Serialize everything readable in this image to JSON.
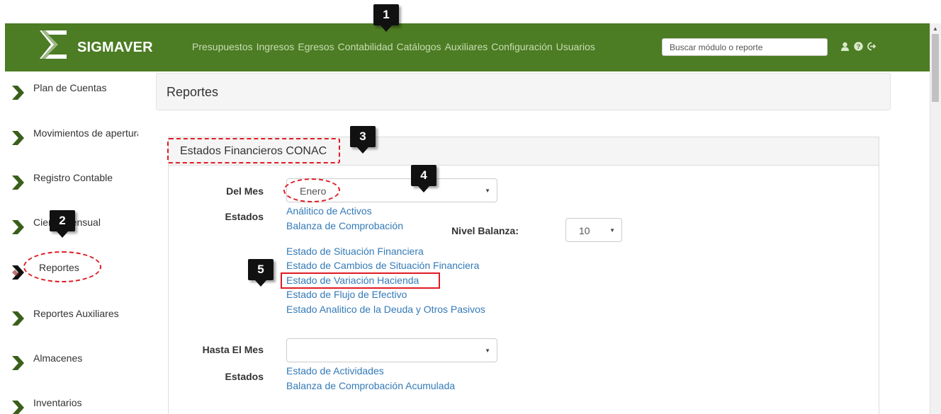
{
  "app": {
    "name": "SIGMAVER"
  },
  "nav": {
    "items": [
      "Presupuestos",
      "Ingresos",
      "Egresos",
      "Contabilidad",
      "Catálogos",
      "Auxiliares",
      "Configuración",
      "Usuarios"
    ],
    "search_placeholder": "Buscar módulo o reporte",
    "icons": [
      "user-icon",
      "question-circle-icon",
      "sign-out-icon"
    ]
  },
  "sidebar": {
    "items": [
      {
        "label": "Plan de Cuentas",
        "active": false
      },
      {
        "label": "Movimientos de apertura",
        "active": false
      },
      {
        "label": "Registro Contable",
        "active": false
      },
      {
        "label": "Cierre Mensual",
        "active": false
      },
      {
        "label": "Reportes",
        "active": true
      },
      {
        "label": "Reportes Auxiliares",
        "active": false
      },
      {
        "label": "Almacenes",
        "active": false
      },
      {
        "label": "Inventarios",
        "active": false
      }
    ]
  },
  "main": {
    "title": "Reportes",
    "panel": {
      "title": "Estados Financieros CONAC",
      "del_mes": {
        "label": "Del Mes",
        "value": "Enero"
      },
      "estados_label": "Estados",
      "reports_a": [
        "Análitico de Activos",
        "Balanza de Comprobación"
      ],
      "nivel_balanza": {
        "label": "Nivel Balanza:",
        "value": "10"
      },
      "reports_b": [
        "Estado de Situación Financiera",
        "Estado de Cambios de Situación Financiera",
        "Estado de Variación Hacienda",
        "Estado de Flujo de Efectivo",
        "Estado Analitico de la Deuda y Otros Pasivos"
      ],
      "hasta_mes": {
        "label": "Hasta El Mes",
        "value": ""
      },
      "estados_label_2": "Estados",
      "reports_c": [
        "Estado de Actividades",
        "Balanza de Comprobación Acumulada"
      ]
    }
  },
  "callouts": [
    "1",
    "2",
    "3",
    "4",
    "5"
  ],
  "colors": {
    "navbar": "#4c7c23",
    "link": "#337ab7",
    "highlight": "#e01b24",
    "callout": "#111111"
  }
}
